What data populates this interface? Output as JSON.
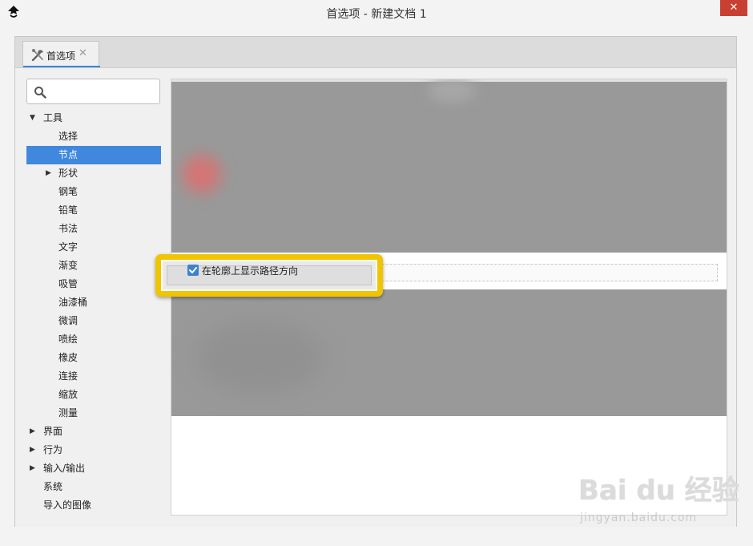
{
  "window": {
    "title": "首选项 - 新建文档 1",
    "close_label": "✕"
  },
  "tab": {
    "label": "首选项",
    "close_label": "✕",
    "icon": "tools-icon"
  },
  "search": {
    "placeholder": "",
    "value": "",
    "icon": "search-icon"
  },
  "tree": {
    "tools": {
      "label": "工具",
      "expanded": true
    },
    "items": [
      {
        "label": "选择"
      },
      {
        "label": "节点",
        "selected": true
      },
      {
        "label": "形状",
        "has_children": true
      },
      {
        "label": "钢笔"
      },
      {
        "label": "铅笔"
      },
      {
        "label": "书法"
      },
      {
        "label": "文字"
      },
      {
        "label": "渐变"
      },
      {
        "label": "吸管"
      },
      {
        "label": "油漆桶"
      },
      {
        "label": "微调"
      },
      {
        "label": "喷绘"
      },
      {
        "label": "橡皮"
      },
      {
        "label": "连接"
      },
      {
        "label": "缩放"
      },
      {
        "label": "测量"
      }
    ],
    "top_items": [
      {
        "label": "界面",
        "has_children": true
      },
      {
        "label": "行为",
        "has_children": true
      },
      {
        "label": "输入/输出",
        "has_children": true
      },
      {
        "label": "系统"
      },
      {
        "label": "导入的图像"
      }
    ]
  },
  "option": {
    "label": "在轮廓上显示路径方向",
    "checked": true
  },
  "watermark": {
    "main": "Bai du 经验",
    "sub": "jingyan.baidu.com"
  },
  "colors": {
    "selection": "#3f88dd",
    "highlight": "#f1c400",
    "close_button": "#c84031"
  }
}
